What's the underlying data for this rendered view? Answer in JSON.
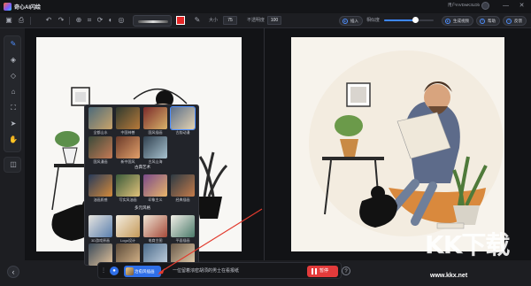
{
  "app": {
    "title": "奇心AI闪绘",
    "user": "用户mVDwK3LDb",
    "logo_icon": "app-logo-icon"
  },
  "window": {
    "minimize": "—",
    "close": "✕"
  },
  "toolbar": {
    "size_label": "大小",
    "size_value": "75",
    "opacity_label": "不透明度",
    "opacity_value": "100",
    "brush_color": "#e52727",
    "pill_insert": "插入",
    "similarity_label": "相似度",
    "similarity_value": 0.62,
    "pill_generate": "生成视频",
    "pill_help": "帮助",
    "pill_feedback": "反馈"
  },
  "popup": {
    "row1": [
      "全都山水",
      "中国神兽",
      "国风插画",
      "古韵动漫"
    ],
    "row2": [
      "国风漫画",
      "新中国风",
      "古风山海"
    ],
    "section2": "古典艺术",
    "row3": [
      "油画质感",
      "写实风油画",
      "印象主义",
      "经典插画"
    ],
    "section3": "多元风格",
    "row4": [
      "3D游戏原画",
      "Logo设计",
      "电商主图",
      "平面插画"
    ],
    "row5": [
      "",
      "",
      "",
      ""
    ]
  },
  "bottombar": {
    "style_chip": "治愈风插画",
    "prompt": "一位留着浓密胡须的男士在看报纸",
    "generate": "暂停"
  },
  "watermark": {
    "big": "KK下载",
    "small": "www.kkx.net"
  }
}
